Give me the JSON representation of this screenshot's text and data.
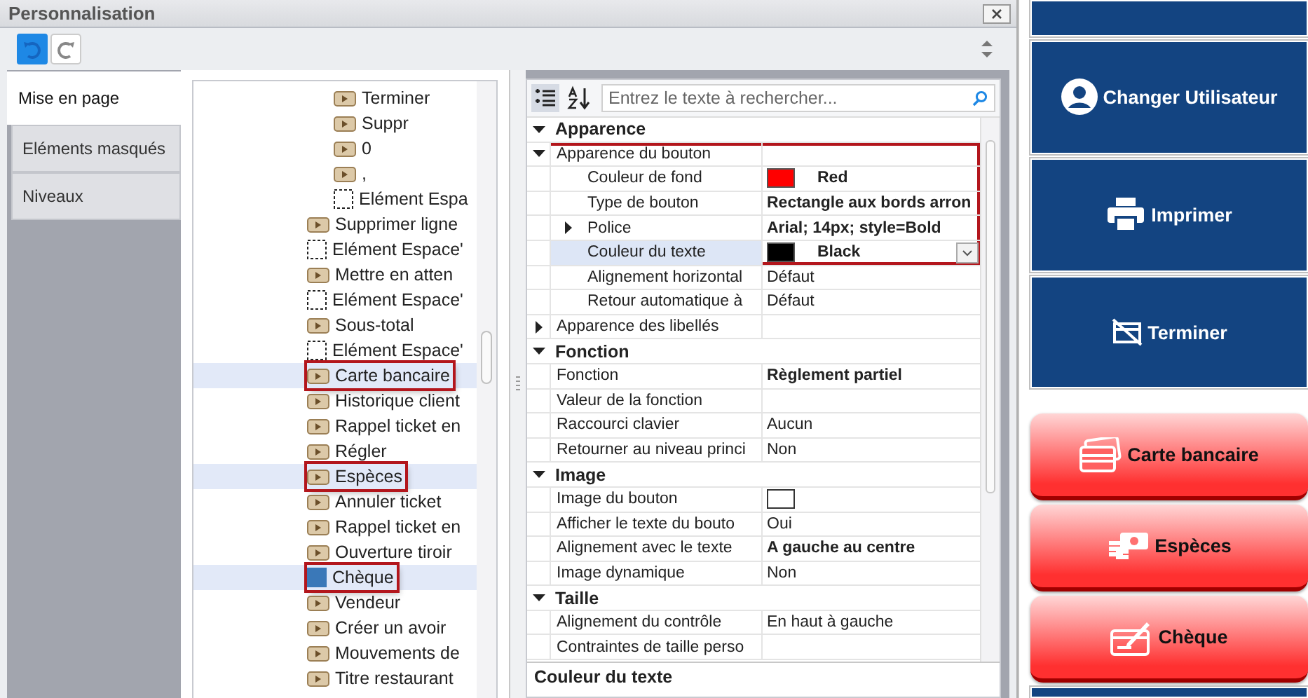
{
  "window": {
    "title": "Personnalisation"
  },
  "side_tabs": [
    {
      "label": "Mise en page",
      "selected": true
    },
    {
      "label": "Eléments masqués",
      "selected": false
    },
    {
      "label": "Niveaux",
      "selected": false
    }
  ],
  "tree": {
    "nested_items": [
      {
        "label": "Terminer",
        "kind": "action",
        "selected": false,
        "outlined": false
      },
      {
        "label": "Suppr",
        "kind": "action",
        "selected": false,
        "outlined": false
      },
      {
        "label": "0",
        "kind": "action",
        "selected": false,
        "outlined": false
      },
      {
        "label": ",",
        "kind": "action",
        "selected": false,
        "outlined": false
      },
      {
        "label": "Elément Espa",
        "kind": "spacer",
        "selected": false,
        "outlined": false
      }
    ],
    "items": [
      {
        "label": "Supprimer ligne",
        "kind": "action",
        "selected": false,
        "outlined": false
      },
      {
        "label": "Elément Espace'",
        "kind": "spacer",
        "selected": false,
        "outlined": false
      },
      {
        "label": "Mettre en atten",
        "kind": "action",
        "selected": false,
        "outlined": false
      },
      {
        "label": "Elément Espace'",
        "kind": "spacer",
        "selected": false,
        "outlined": false
      },
      {
        "label": "Sous-total",
        "kind": "action",
        "selected": false,
        "outlined": false
      },
      {
        "label": "Elément Espace'",
        "kind": "spacer",
        "selected": false,
        "outlined": false
      },
      {
        "label": "Carte bancaire",
        "kind": "action",
        "selected": true,
        "outlined": true
      },
      {
        "label": "Historique client",
        "kind": "action",
        "selected": false,
        "outlined": false
      },
      {
        "label": "Rappel ticket en",
        "kind": "action",
        "selected": false,
        "outlined": false
      },
      {
        "label": "Régler",
        "kind": "action",
        "selected": false,
        "outlined": false
      },
      {
        "label": "Espèces",
        "kind": "action",
        "selected": true,
        "outlined": true
      },
      {
        "label": "Annuler ticket",
        "kind": "action",
        "selected": false,
        "outlined": false
      },
      {
        "label": "Rappel ticket en",
        "kind": "action",
        "selected": false,
        "outlined": false
      },
      {
        "label": "Ouverture tiroir",
        "kind": "action",
        "selected": false,
        "outlined": false
      },
      {
        "label": "Chèque",
        "kind": "square",
        "selected": true,
        "outlined": true
      },
      {
        "label": "Vendeur",
        "kind": "action",
        "selected": false,
        "outlined": false
      },
      {
        "label": "Créer un avoir",
        "kind": "action",
        "selected": false,
        "outlined": false
      },
      {
        "label": "Mouvements de",
        "kind": "action",
        "selected": false,
        "outlined": false
      },
      {
        "label": "Titre restaurant",
        "kind": "action",
        "selected": false,
        "outlined": false
      }
    ]
  },
  "property_grid": {
    "search_placeholder": "Entrez le texte à rechercher...",
    "categories": [
      {
        "label": "Apparence",
        "expanded": true,
        "rows": [
          {
            "label": "Apparence du bouton",
            "kind": "text",
            "selected": false,
            "outlined": true,
            "expanded": true,
            "children": [
              {
                "label": "Couleur de fond",
                "kind": "color",
                "color": "#ff0000",
                "value": "Red",
                "bold": true,
                "selected": false,
                "outlined": true
              },
              {
                "label": "Type de bouton",
                "kind": "text",
                "value": "Rectangle aux bords arron",
                "bold": true,
                "selected": false,
                "outlined": true
              },
              {
                "label": "Police",
                "kind": "text",
                "value": "Arial; 14px; style=Bold",
                "bold": true,
                "selected": false,
                "outlined": true,
                "expanded": false
              },
              {
                "label": "Couleur du texte",
                "kind": "color",
                "color": "#000000",
                "value": "Black",
                "bold": true,
                "selected": true,
                "outlined": true
              },
              {
                "label": "Alignement horizontal",
                "kind": "text",
                "value": "Défaut",
                "bold": false,
                "selected": false,
                "outlined": false
              },
              {
                "label": "Retour automatique à",
                "kind": "text",
                "value": "Défaut",
                "bold": false,
                "selected": false,
                "outlined": false
              }
            ]
          },
          {
            "label": "Apparence des libellés",
            "kind": "text",
            "selected": false,
            "outlined": false,
            "expanded": false
          }
        ]
      },
      {
        "label": "Fonction",
        "expanded": true,
        "rows": [
          {
            "label": "Fonction",
            "kind": "text",
            "value": "Règlement partiel",
            "bold": true,
            "selected": false,
            "outlined": false
          },
          {
            "label": "Valeur de la fonction",
            "kind": "text",
            "selected": false,
            "outlined": false
          },
          {
            "label": "Raccourci clavier",
            "kind": "text",
            "value": "Aucun",
            "bold": false,
            "selected": false,
            "outlined": false
          },
          {
            "label": "Retourner au niveau princi",
            "kind": "text",
            "value": "Non",
            "bold": false,
            "selected": false,
            "outlined": false
          }
        ]
      },
      {
        "label": "Image",
        "expanded": true,
        "rows": [
          {
            "label": "Image du bouton",
            "kind": "image",
            "selected": false,
            "outlined": false
          },
          {
            "label": "Afficher le texte du bouto",
            "kind": "text",
            "value": "Oui",
            "bold": false,
            "selected": false,
            "outlined": false
          },
          {
            "label": "Alignement avec le texte",
            "kind": "text",
            "value": "A gauche au centre",
            "bold": true,
            "selected": false,
            "outlined": false
          },
          {
            "label": "Image dynamique",
            "kind": "text",
            "value": "Non",
            "bold": false,
            "selected": false,
            "outlined": false
          }
        ]
      },
      {
        "label": "Taille",
        "expanded": true,
        "rows": [
          {
            "label": "Alignement du contrôle",
            "kind": "text",
            "value": "En haut à gauche",
            "bold": false,
            "selected": false,
            "outlined": false
          },
          {
            "label": "Contraintes de taille perso",
            "kind": "text",
            "selected": false,
            "outlined": false
          }
        ]
      }
    ],
    "description": "Couleur du texte"
  },
  "pos_buttons": [
    {
      "label": "Changer Utilisateur",
      "kind": "user",
      "color": "#134481"
    },
    {
      "label": "Imprimer",
      "kind": "printer",
      "color": "#134481"
    },
    {
      "label": "Terminer",
      "kind": "finish",
      "color": "#134481"
    },
    {
      "label": "Carte bancaire",
      "kind": "card",
      "color": "#ff3030"
    },
    {
      "label": "Espèces",
      "kind": "cash",
      "color": "#ff3030"
    },
    {
      "label": "Chèque",
      "kind": "cheque",
      "color": "#ff3030"
    }
  ]
}
